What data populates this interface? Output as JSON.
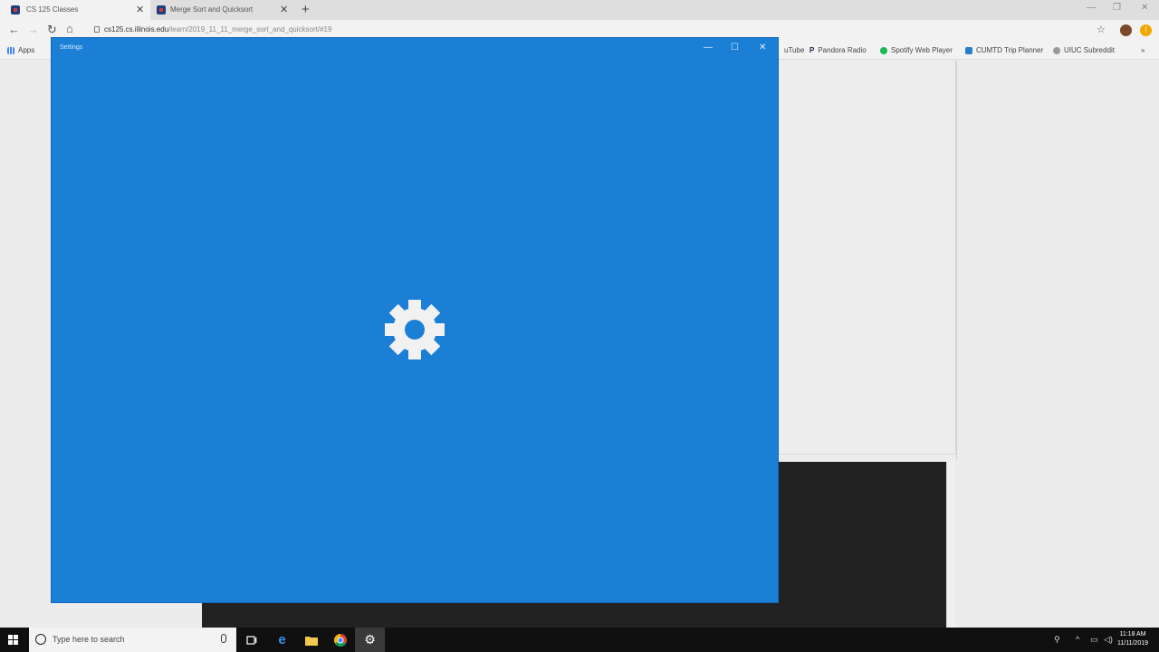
{
  "browser": {
    "tabs": [
      {
        "title": "CS 125 Classes"
      },
      {
        "title": "Merge Sort and Quicksort"
      }
    ],
    "new_tab_label": "+",
    "url_host": "cs125.cs.illinois.edu",
    "url_path": "/learn/2019_11_11_merge_sort_and_quicksort/#19",
    "bookmarks": [
      "Apps",
      "uTube",
      "Pandora Radio",
      "Spotify Web Player",
      "CUMTD Trip Planner",
      "UIUC Subreddit"
    ],
    "bookmarks_overflow": "»"
  },
  "settings_window": {
    "title": "Settings",
    "icon": "gear-icon",
    "accent_color": "#1b7fd6"
  },
  "taskbar": {
    "search_placeholder": "Type here to search",
    "pinned": [
      "task-view-icon",
      "edge-icon",
      "file-explorer-icon",
      "chrome-icon",
      "settings-icon"
    ],
    "clock_time": "11:18 AM",
    "clock_date": "11/11/2019"
  }
}
